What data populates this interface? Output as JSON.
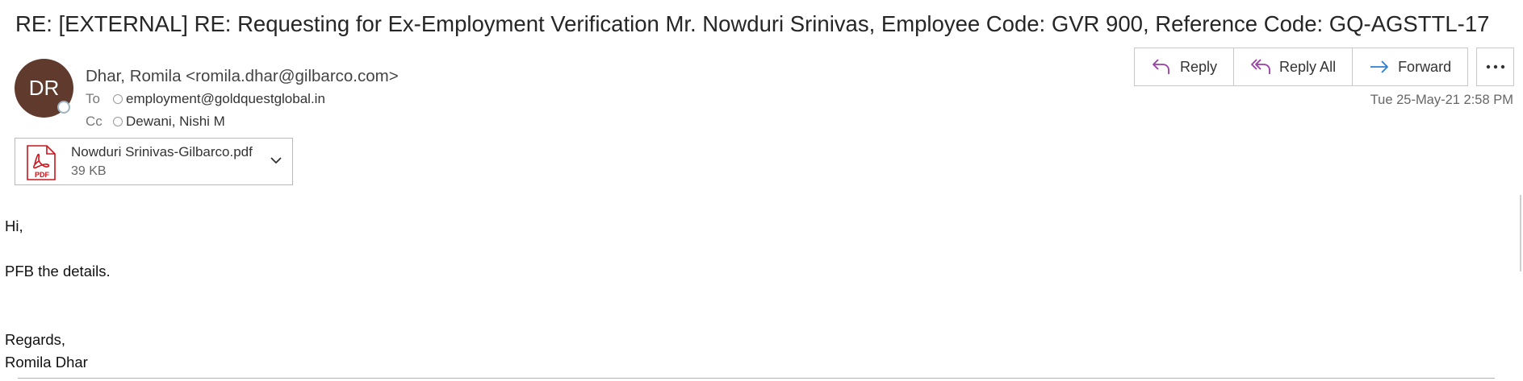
{
  "email": {
    "subject": "RE: [EXTERNAL] RE: Requesting for Ex-Employment Verification Mr. Nowduri Srinivas, Employee Code: GVR 900, Reference Code: GQ-AGSTTL-17",
    "avatar_initials": "DR",
    "sender": "Dhar, Romila <romila.dhar@gilbarco.com>",
    "to_label": "To",
    "to": "employment@goldquestglobal.in",
    "cc_label": "Cc",
    "cc": "Dewani, Nishi M",
    "date": "Tue 25-May-21 2:58 PM"
  },
  "actions": {
    "reply": "Reply",
    "reply_all": "Reply All",
    "forward": "Forward"
  },
  "attachment": {
    "name": "Nowduri Srinivas-Gilbarco.pdf",
    "size": "39 KB",
    "icon_label": "PDF"
  },
  "body": {
    "greeting": "Hi,",
    "line1": "PFB the details.",
    "closing": "Regards,",
    "signature": "Romila Dhar"
  },
  "colors": {
    "avatar": "#5f3a2d",
    "accent_purple": "#9b3ea8",
    "accent_blue": "#2b7fd1",
    "pdf_red": "#c8161d"
  },
  "icons": [
    "reply-icon",
    "reply-all-icon",
    "forward-icon",
    "more-options-icon",
    "pdf-icon",
    "chevron-down-icon"
  ]
}
